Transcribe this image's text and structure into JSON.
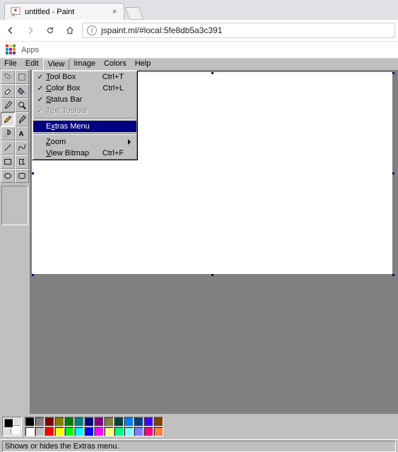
{
  "browser": {
    "tab_title": "untitled - Paint",
    "url": "jspaint.ml/#local:5fe8db5a3c391",
    "apps_label": "Apps"
  },
  "menu": {
    "items": [
      "File",
      "Edit",
      "View",
      "Image",
      "Colors",
      "Help"
    ],
    "open_index": 2,
    "view_menu": {
      "tool_box": {
        "label_pre": "",
        "u": "T",
        "label_post": "ool Box",
        "shortcut": "Ctrl+T",
        "checked": true
      },
      "color_box": {
        "label_pre": "",
        "u": "C",
        "label_post": "olor Box",
        "shortcut": "Ctrl+L",
        "checked": true
      },
      "status_bar": {
        "label_pre": "",
        "u": "S",
        "label_post": "tatus Bar",
        "shortcut": "",
        "checked": true
      },
      "text_toolbar": {
        "label_pre": "T",
        "u": "e",
        "label_post": "xt Toolbar",
        "shortcut": "",
        "checked": true,
        "disabled": true
      },
      "extras_menu": {
        "label_pre": "E",
        "u": "x",
        "label_post": "tras Menu",
        "shortcut": "",
        "highlight": true
      },
      "zoom": {
        "label_pre": "",
        "u": "Z",
        "label_post": "oom",
        "submenu": true
      },
      "view_bitmap": {
        "label_pre": "",
        "u": "V",
        "label_post": "iew Bitmap",
        "shortcut": "Ctrl+F"
      }
    }
  },
  "tools": [
    {
      "name": "free-form-select-tool"
    },
    {
      "name": "select-tool"
    },
    {
      "name": "eraser-tool"
    },
    {
      "name": "fill-tool"
    },
    {
      "name": "pick-color-tool"
    },
    {
      "name": "magnifier-tool"
    },
    {
      "name": "pencil-tool",
      "active": true
    },
    {
      "name": "brush-tool"
    },
    {
      "name": "airbrush-tool"
    },
    {
      "name": "text-tool"
    },
    {
      "name": "line-tool"
    },
    {
      "name": "curve-tool"
    },
    {
      "name": "rectangle-tool"
    },
    {
      "name": "polygon-tool"
    },
    {
      "name": "ellipse-tool"
    },
    {
      "name": "rounded-rectangle-tool"
    }
  ],
  "palette_row1": [
    "#000000",
    "#808080",
    "#800000",
    "#808000",
    "#008000",
    "#008080",
    "#000080",
    "#800080",
    "#808040",
    "#004040",
    "#0080ff",
    "#004080",
    "#4000ff",
    "#804000"
  ],
  "palette_row2": [
    "#ffffff",
    "#c0c0c0",
    "#ff0000",
    "#ffff00",
    "#00ff00",
    "#00ffff",
    "#0000ff",
    "#ff00ff",
    "#ffff80",
    "#00ff80",
    "#80ffff",
    "#8080ff",
    "#ff0080",
    "#ff8040"
  ],
  "colors": {
    "fg": "#000000",
    "bg": "#ffffff"
  },
  "status": {
    "text": "Shows or hides the Extras menu."
  }
}
